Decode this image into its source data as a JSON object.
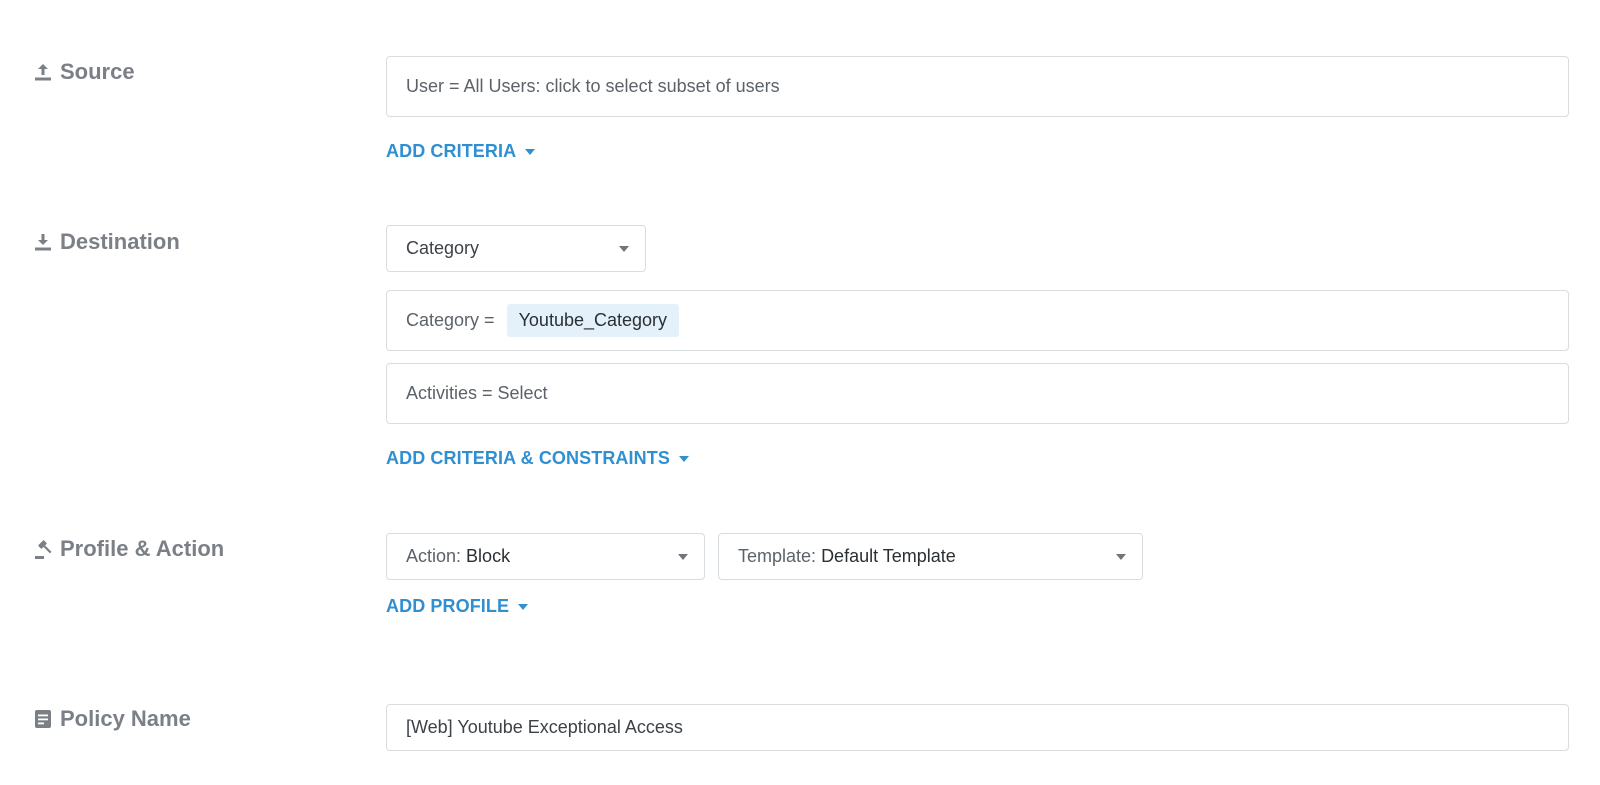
{
  "source": {
    "label": "Source",
    "icon": "upload-icon",
    "users_field": "User = All Users: click to select subset of users",
    "add_criteria": "ADD CRITERIA"
  },
  "destination": {
    "label": "Destination",
    "icon": "download-icon",
    "type_select": "Category",
    "category_prefix": "Category =",
    "category_tag": "Youtube_Category",
    "activities_field": "Activities = Select",
    "add_criteria_constraints": "ADD CRITERIA & CONSTRAINTS"
  },
  "profile_action": {
    "label": "Profile & Action",
    "icon": "gavel-icon",
    "action_prefix": "Action:",
    "action_value": "Block",
    "template_prefix": "Template:",
    "template_value": "Default Template",
    "add_profile": "ADD PROFILE"
  },
  "policy_name": {
    "label": "Policy Name",
    "icon": "document-icon",
    "value": "[Web] Youtube Exceptional Access"
  },
  "colors": {
    "link": "#2f8fd1",
    "label": "#7b8087",
    "tag_bg": "#e4f1fa",
    "border": "#d9dcdf"
  }
}
